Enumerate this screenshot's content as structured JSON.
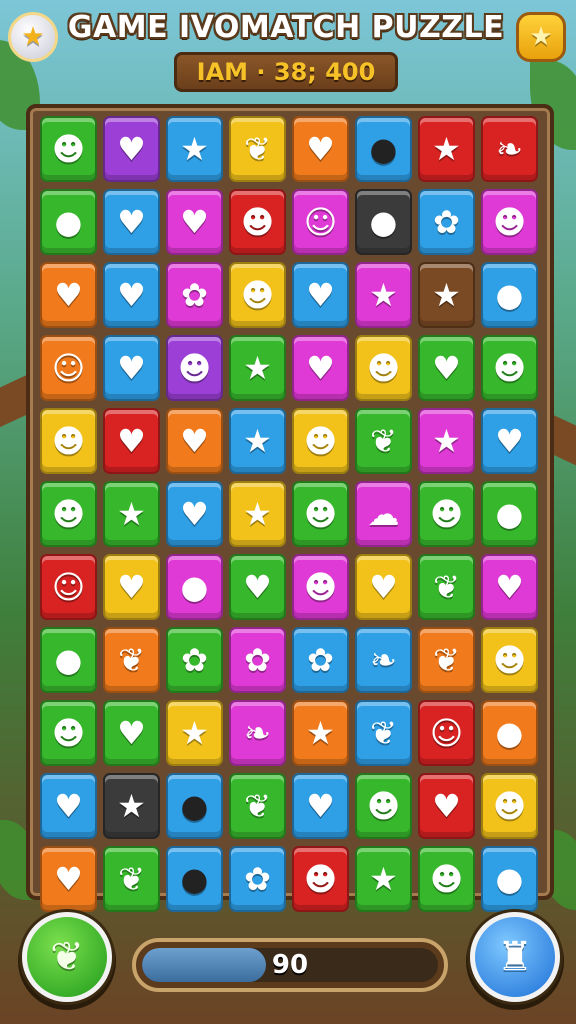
{
  "header": {
    "title": "GAME IVOMATCH PUZZLE",
    "score": "IAM · 38; 400",
    "left_button_icon": "star-badge-icon",
    "right_button_icon": "star-icon"
  },
  "colors": {
    "green": "#37b82c",
    "purple": "#9b3fd6",
    "blue": "#2f9fe6",
    "yellow": "#f2c21b",
    "orange": "#f07a1c",
    "dark": "#3b3b3b",
    "red": "#d92222",
    "magenta": "#e03ad6",
    "brown": "#7a4a24"
  },
  "icon_glyphs": {
    "smiley": "☻",
    "heart": "♥",
    "star": "★",
    "leaf": "❦",
    "apple": "●",
    "bomb": "●",
    "face": "☺",
    "pepper": "❧",
    "fruit": "✿",
    "blob": "☁"
  },
  "board": {
    "rows": [
      [
        {
          "c": "green",
          "i": "smiley"
        },
        {
          "c": "purple",
          "i": "heart"
        },
        {
          "c": "blue",
          "i": "star"
        },
        {
          "c": "yellow",
          "i": "leaf"
        },
        {
          "c": "orange",
          "i": "heart"
        },
        {
          "c": "blue",
          "i": "bomb"
        },
        {
          "c": "red",
          "i": "star"
        },
        {
          "c": "red",
          "i": "pepper"
        }
      ],
      [
        {
          "c": "green",
          "i": "apple"
        },
        {
          "c": "blue",
          "i": "heart"
        },
        {
          "c": "magenta",
          "i": "heart"
        },
        {
          "c": "red",
          "i": "smiley"
        },
        {
          "c": "magenta",
          "i": "face"
        },
        {
          "c": "dark",
          "i": "apple"
        },
        {
          "c": "blue",
          "i": "fruit"
        },
        {
          "c": "magenta",
          "i": "smiley"
        }
      ],
      [
        {
          "c": "orange",
          "i": "heart"
        },
        {
          "c": "blue",
          "i": "heart"
        },
        {
          "c": "magenta",
          "i": "fruit"
        },
        {
          "c": "yellow",
          "i": "smiley"
        },
        {
          "c": "blue",
          "i": "heart"
        },
        {
          "c": "magenta",
          "i": "star"
        },
        {
          "c": "brown",
          "i": "star"
        },
        {
          "c": "blue",
          "i": "apple"
        }
      ],
      [
        {
          "c": "orange",
          "i": "face"
        },
        {
          "c": "blue",
          "i": "heart"
        },
        {
          "c": "purple",
          "i": "smiley"
        },
        {
          "c": "green",
          "i": "star"
        },
        {
          "c": "magenta",
          "i": "heart"
        },
        {
          "c": "yellow",
          "i": "smiley"
        },
        {
          "c": "green",
          "i": "heart"
        },
        {
          "c": "green",
          "i": "smiley"
        }
      ],
      [
        {
          "c": "yellow",
          "i": "smiley"
        },
        {
          "c": "red",
          "i": "heart"
        },
        {
          "c": "orange",
          "i": "heart"
        },
        {
          "c": "blue",
          "i": "star"
        },
        {
          "c": "yellow",
          "i": "smiley"
        },
        {
          "c": "green",
          "i": "leaf"
        },
        {
          "c": "magenta",
          "i": "star"
        },
        {
          "c": "blue",
          "i": "heart"
        }
      ],
      [
        {
          "c": "green",
          "i": "smiley"
        },
        {
          "c": "green",
          "i": "star"
        },
        {
          "c": "blue",
          "i": "heart"
        },
        {
          "c": "yellow",
          "i": "star"
        },
        {
          "c": "green",
          "i": "smiley"
        },
        {
          "c": "magenta",
          "i": "blob"
        },
        {
          "c": "green",
          "i": "smiley"
        },
        {
          "c": "green",
          "i": "apple"
        }
      ],
      [
        {
          "c": "red",
          "i": "face"
        },
        {
          "c": "yellow",
          "i": "heart"
        },
        {
          "c": "magenta",
          "i": "apple"
        },
        {
          "c": "green",
          "i": "heart"
        },
        {
          "c": "magenta",
          "i": "smiley"
        },
        {
          "c": "yellow",
          "i": "heart"
        },
        {
          "c": "green",
          "i": "leaf"
        },
        {
          "c": "magenta",
          "i": "heart"
        }
      ],
      [
        {
          "c": "green",
          "i": "apple"
        },
        {
          "c": "orange",
          "i": "leaf"
        },
        {
          "c": "green",
          "i": "fruit"
        },
        {
          "c": "magenta",
          "i": "fruit"
        },
        {
          "c": "blue",
          "i": "fruit"
        },
        {
          "c": "blue",
          "i": "pepper"
        },
        {
          "c": "orange",
          "i": "leaf"
        },
        {
          "c": "yellow",
          "i": "smiley"
        }
      ],
      [
        {
          "c": "green",
          "i": "smiley"
        },
        {
          "c": "green",
          "i": "heart"
        },
        {
          "c": "yellow",
          "i": "star"
        },
        {
          "c": "magenta",
          "i": "pepper"
        },
        {
          "c": "orange",
          "i": "star"
        },
        {
          "c": "blue",
          "i": "leaf"
        },
        {
          "c": "red",
          "i": "face"
        },
        {
          "c": "orange",
          "i": "apple"
        }
      ],
      [
        {
          "c": "blue",
          "i": "heart"
        },
        {
          "c": "dark",
          "i": "star"
        },
        {
          "c": "blue",
          "i": "bomb"
        },
        {
          "c": "green",
          "i": "leaf"
        },
        {
          "c": "blue",
          "i": "heart"
        },
        {
          "c": "green",
          "i": "smiley"
        },
        {
          "c": "red",
          "i": "heart"
        },
        {
          "c": "yellow",
          "i": "smiley"
        }
      ],
      [
        {
          "c": "orange",
          "i": "heart"
        },
        {
          "c": "green",
          "i": "leaf"
        },
        {
          "c": "blue",
          "i": "bomb"
        },
        {
          "c": "blue",
          "i": "fruit"
        },
        {
          "c": "red",
          "i": "smiley"
        },
        {
          "c": "green",
          "i": "star"
        },
        {
          "c": "green",
          "i": "smiley"
        },
        {
          "c": "blue",
          "i": "apple"
        }
      ]
    ]
  },
  "footer": {
    "progress_value": "90",
    "progress_fraction": 0.42,
    "left_button_icon": "leaf-card-icon",
    "right_button_icon": "tooth-powerup-icon"
  }
}
